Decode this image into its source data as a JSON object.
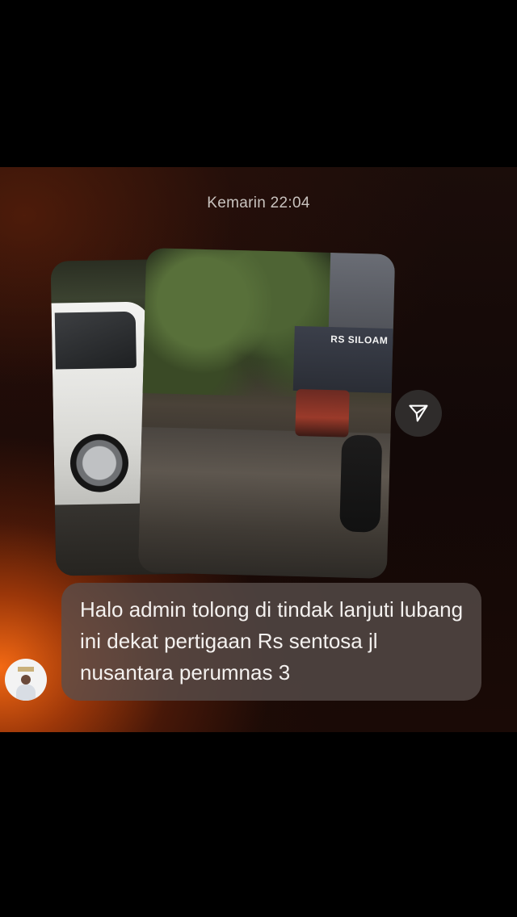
{
  "chat": {
    "timestamp": "Kemarin 22:04",
    "photo_sign_text": "RS SILOAM",
    "message_text": "Halo admin tolong di tindak lanjuti lubang ini dekat pertigaan Rs sentosa jl nusantara perumnas 3"
  },
  "icons": {
    "share": "send-arrow-icon"
  },
  "colors": {
    "accent_orange": "#ff6e14",
    "bubble_bg": "#584e4c",
    "text": "#f4f1ef"
  }
}
